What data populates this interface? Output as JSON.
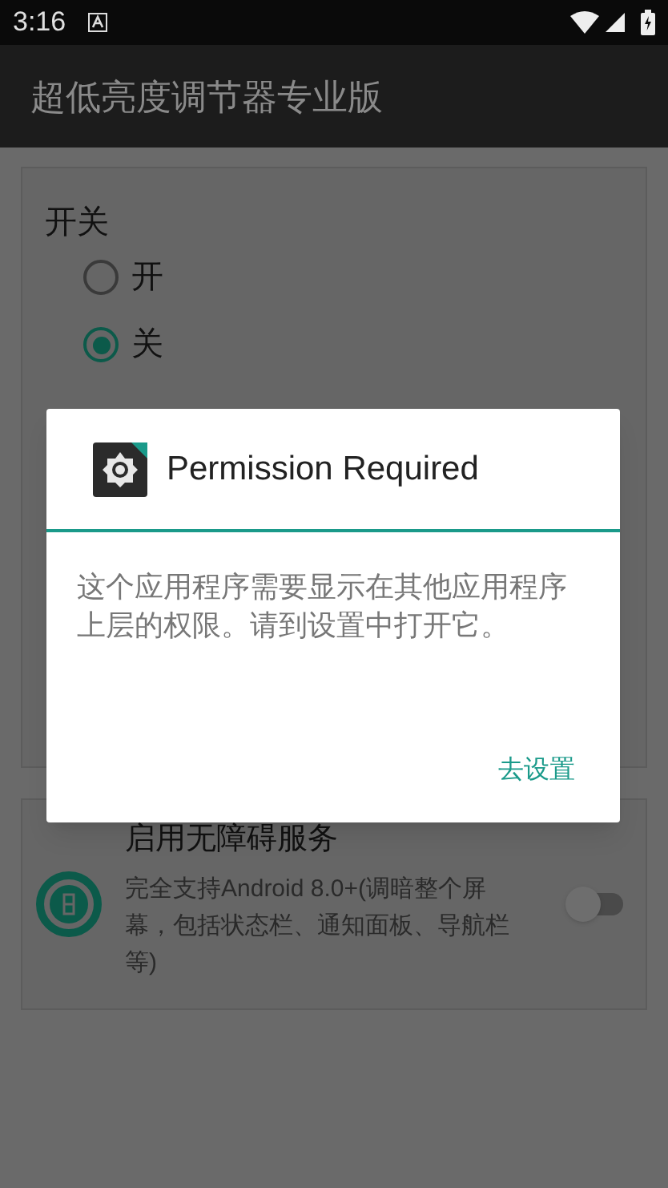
{
  "status_bar": {
    "time": "3:16"
  },
  "app_bar": {
    "title": "超低亮度调节器专业版"
  },
  "switch_card": {
    "title": "开关",
    "options": [
      {
        "label": "开",
        "selected": false
      },
      {
        "label": "关",
        "selected": true
      }
    ]
  },
  "accessibility_card": {
    "title": "启用无障碍服务",
    "description": "完全支持Android 8.0+(调暗整个屏幕，包括状态栏、通知面板、导航栏等)",
    "on": false
  },
  "dialog": {
    "title": "Permission Required",
    "message": "这个应用程序需要显示在其他应用程序上层的权限。请到设置中打开它。",
    "button": "去设置"
  }
}
